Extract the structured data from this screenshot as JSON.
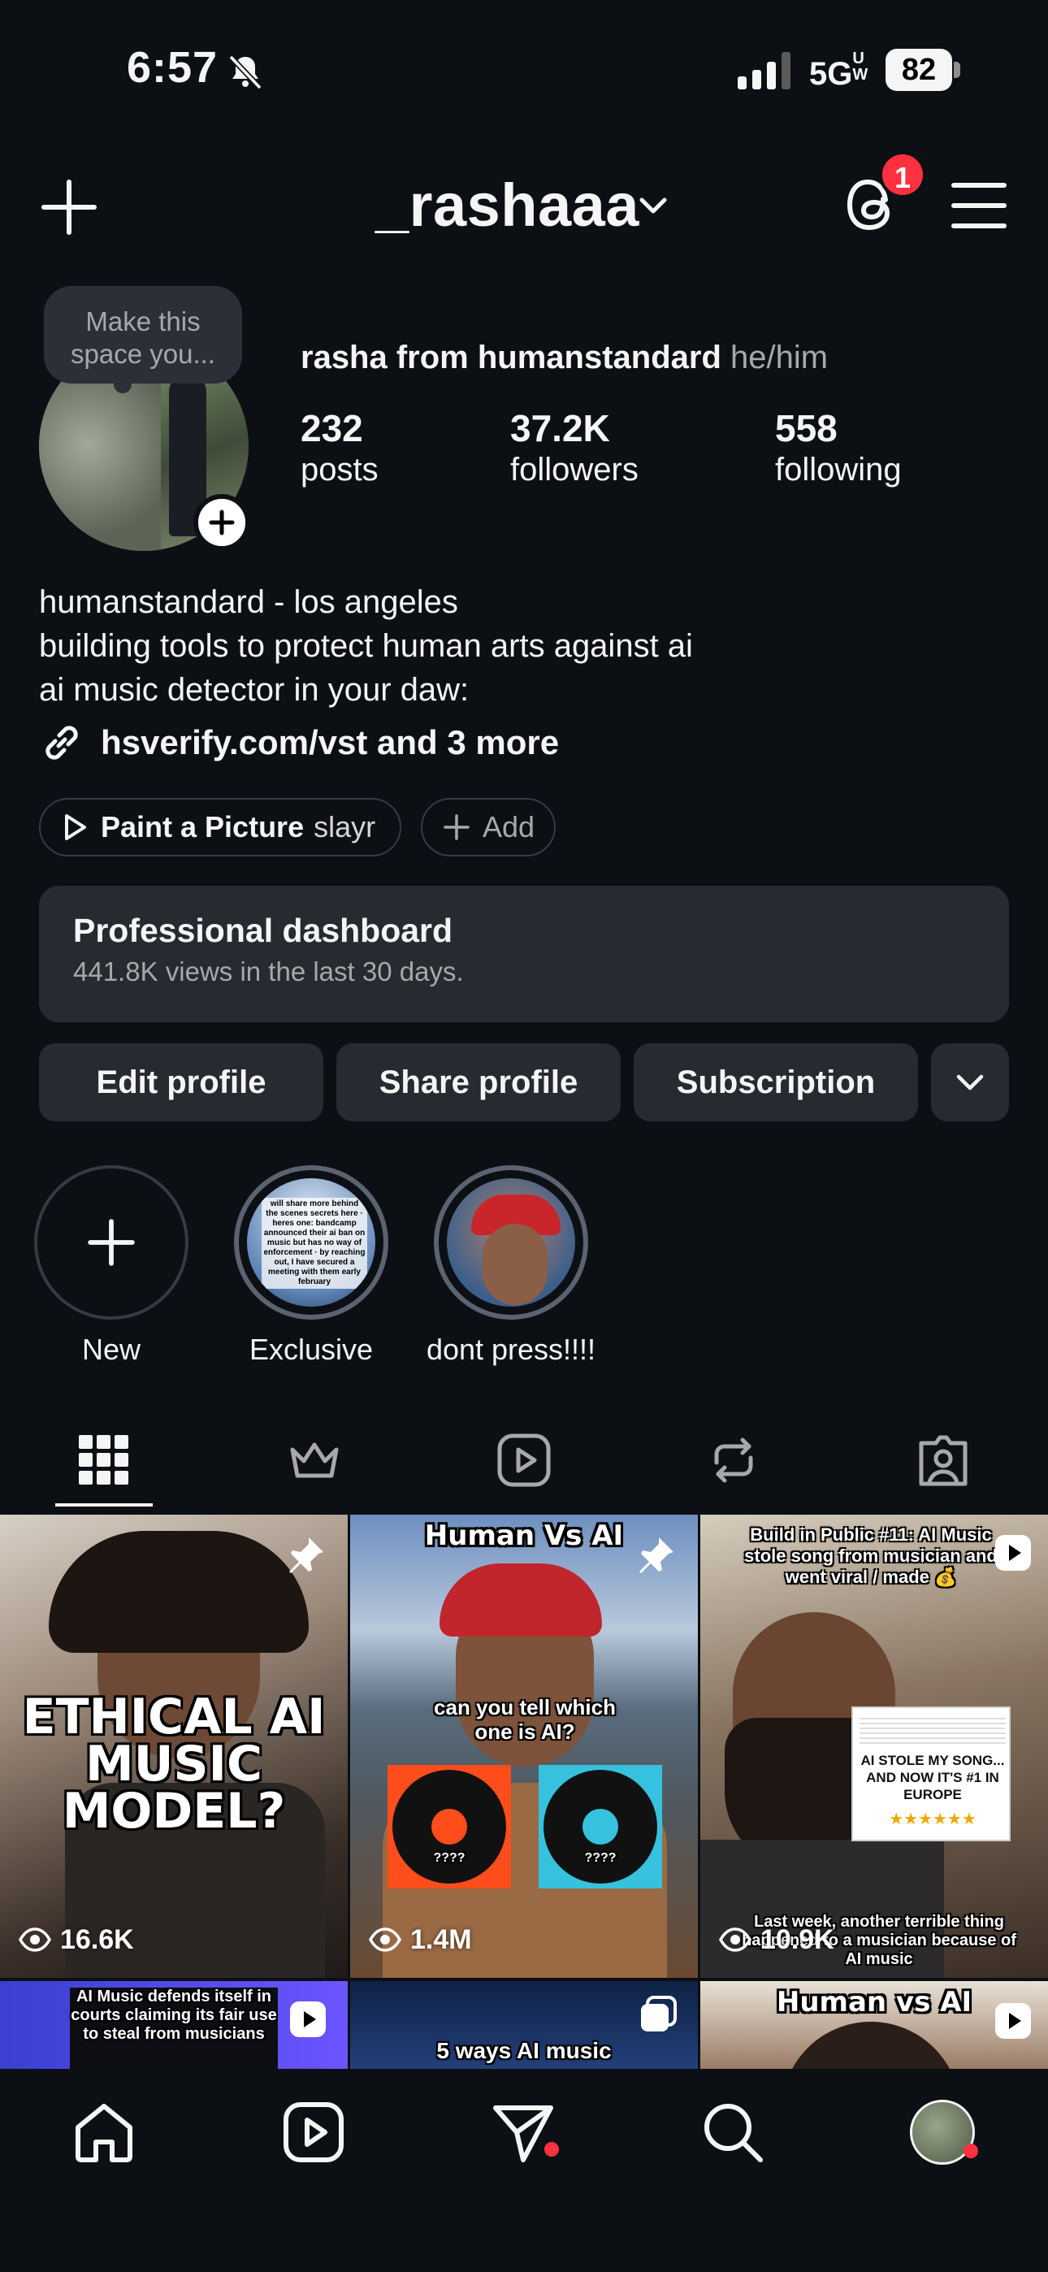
{
  "status_bar": {
    "time": "6:57",
    "network": "5G",
    "network_sub": "UW",
    "battery": "82"
  },
  "header": {
    "username": "_rashaaa",
    "threads_badge": "1"
  },
  "profile": {
    "note": "Make this space you...",
    "full_name": "rasha from humanstandard",
    "pronouns": "he/him",
    "stats": [
      {
        "value": "232",
        "label": "posts"
      },
      {
        "value": "37.2K",
        "label": "followers"
      },
      {
        "value": "558",
        "label": "following"
      }
    ],
    "bio": [
      "humanstandard - los angeles",
      "building tools to protect human arts against ai",
      "ai music detector in your daw:"
    ],
    "link": "hsverify.com/vst and 3 more",
    "music_pill": {
      "title": "Paint a Picture",
      "artist": "slayr"
    },
    "add_pill": "Add"
  },
  "dashboard": {
    "title": "Professional dashboard",
    "subtitle": "441.8K views in the last 30 days."
  },
  "buttons": {
    "edit": "Edit profile",
    "share": "Share profile",
    "subscription": "Subscription"
  },
  "highlights": [
    {
      "label": "New"
    },
    {
      "label": "Exclusive",
      "preview_text": "will share more behind the scenes secrets here · heres one: bandcamp announced their ai ban on music but has no way of enforcement · by reaching out, I have secured a meeting with them early february"
    },
    {
      "label": "dont press!!!!"
    }
  ],
  "tabs": [
    "grid-icon",
    "crown-icon",
    "reels-icon",
    "repost-icon",
    "tagged-icon"
  ],
  "posts": [
    {
      "caption": "ETHICAL AI MUSIC MODEL?",
      "views": "16.6K",
      "pinned": true
    },
    {
      "title": "Human Vs AI",
      "caption": "can you tell which one is AI?",
      "left_disc": "????",
      "right_disc": "????",
      "views": "1.4M",
      "pinned": true
    },
    {
      "caption_top": "Build in Public #11: AI Music stole song from musician and went viral / made 💰",
      "card_text": "AI STOLE MY SONG... AND NOW IT'S #1 IN EUROPE",
      "caption_bottom": "Last week, another terrible thing happened to a musician because of AI music",
      "views": "10.9K"
    },
    {
      "caption": "AI Music defends itself in courts claiming its fair use to steal from musicians"
    },
    {
      "caption": "5 ways AI music"
    },
    {
      "caption": "Human vs AI"
    }
  ],
  "colors": {
    "background": "#0c1014",
    "surface": "#262a31",
    "accent_red": "#ff3040",
    "muted": "#a8a8a8"
  }
}
